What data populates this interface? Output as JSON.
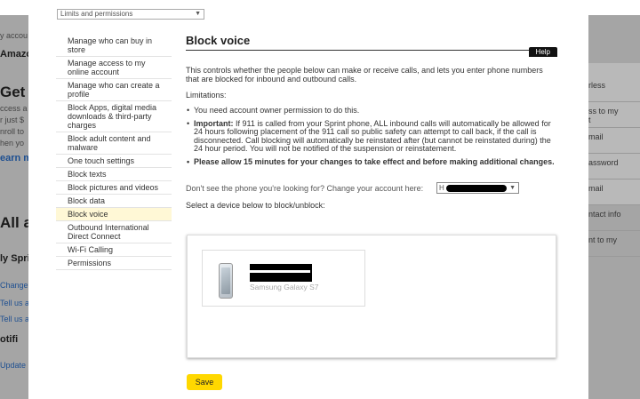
{
  "background": {
    "left": [
      {
        "text": "y accou",
        "style": "small"
      },
      {
        "text": "Amazon",
        "style": "small-bold"
      },
      {
        "text": "Get A",
        "style": "big"
      },
      {
        "text": "ccess a",
        "style": "small"
      },
      {
        "text": "r just $",
        "style": "small"
      },
      {
        "text": "nroll to",
        "style": "small"
      },
      {
        "text": "hen yo",
        "style": "small"
      },
      {
        "text": "earn m",
        "style": "link-bold"
      },
      {
        "text": "All a",
        "style": "big"
      },
      {
        "text": "ly Spri",
        "style": "med"
      },
      {
        "text": "Change",
        "style": "link"
      },
      {
        "text": "Tell us a",
        "style": "link"
      },
      {
        "text": "Tell us a",
        "style": "link"
      },
      {
        "text": "otifi",
        "style": "med"
      },
      {
        "text": "Update",
        "style": "link"
      }
    ],
    "right": [
      "rless",
      "ss to my\nt",
      "mail",
      "assword",
      "mail",
      "ntact info",
      "nt to my"
    ]
  },
  "modal": {
    "top_select": "Limits and permissions",
    "nav": [
      {
        "label": "Manage who can buy in store",
        "active": false
      },
      {
        "label": "Manage access to my online account",
        "active": false
      },
      {
        "label": "Manage who can create a profile",
        "active": false
      },
      {
        "label": "Block Apps, digital media downloads & third-party charges",
        "active": false
      },
      {
        "label": "Block adult content and malware",
        "active": false
      },
      {
        "label": "One touch settings",
        "active": false
      },
      {
        "label": "Block texts",
        "active": false
      },
      {
        "label": "Block pictures and videos",
        "active": false
      },
      {
        "label": "Block data",
        "active": false
      },
      {
        "label": "Block voice",
        "active": true
      },
      {
        "label": "Outbound International Direct Connect",
        "active": false
      },
      {
        "label": "Wi-Fi Calling",
        "active": false
      },
      {
        "label": "Permissions",
        "active": false
      }
    ],
    "title": "Block voice",
    "help": "Help",
    "description": "This controls whether the people below can make or receive calls, and lets you enter phone numbers that are blocked for inbound and outbound calls.",
    "limitations_label": "Limitations:",
    "limit_1": "You need account owner permission to do this.",
    "limit_2_bold": "Important:",
    "limit_2_text": " If 911 is called from your Sprint phone, ALL inbound calls will automatically be allowed for 24 hours following placement of the 911 call so public safety can attempt to call back, if the call is disconnected. Call blocking will automatically be reinstated after (but cannot be reinstated during) the 24 hour period. You will not be notified of the suspension or reinstatement.",
    "limit_3": "Please allow 15 minutes for your changes to take effect and before making additional changes.",
    "account_prompt": "Don't see the phone you're looking for? Change your account here:",
    "account_select_value": "H",
    "select_device_label": "Select a device below to block/unblock:",
    "device": {
      "model": "Samsung Galaxy S7"
    },
    "save_label": "Save"
  }
}
